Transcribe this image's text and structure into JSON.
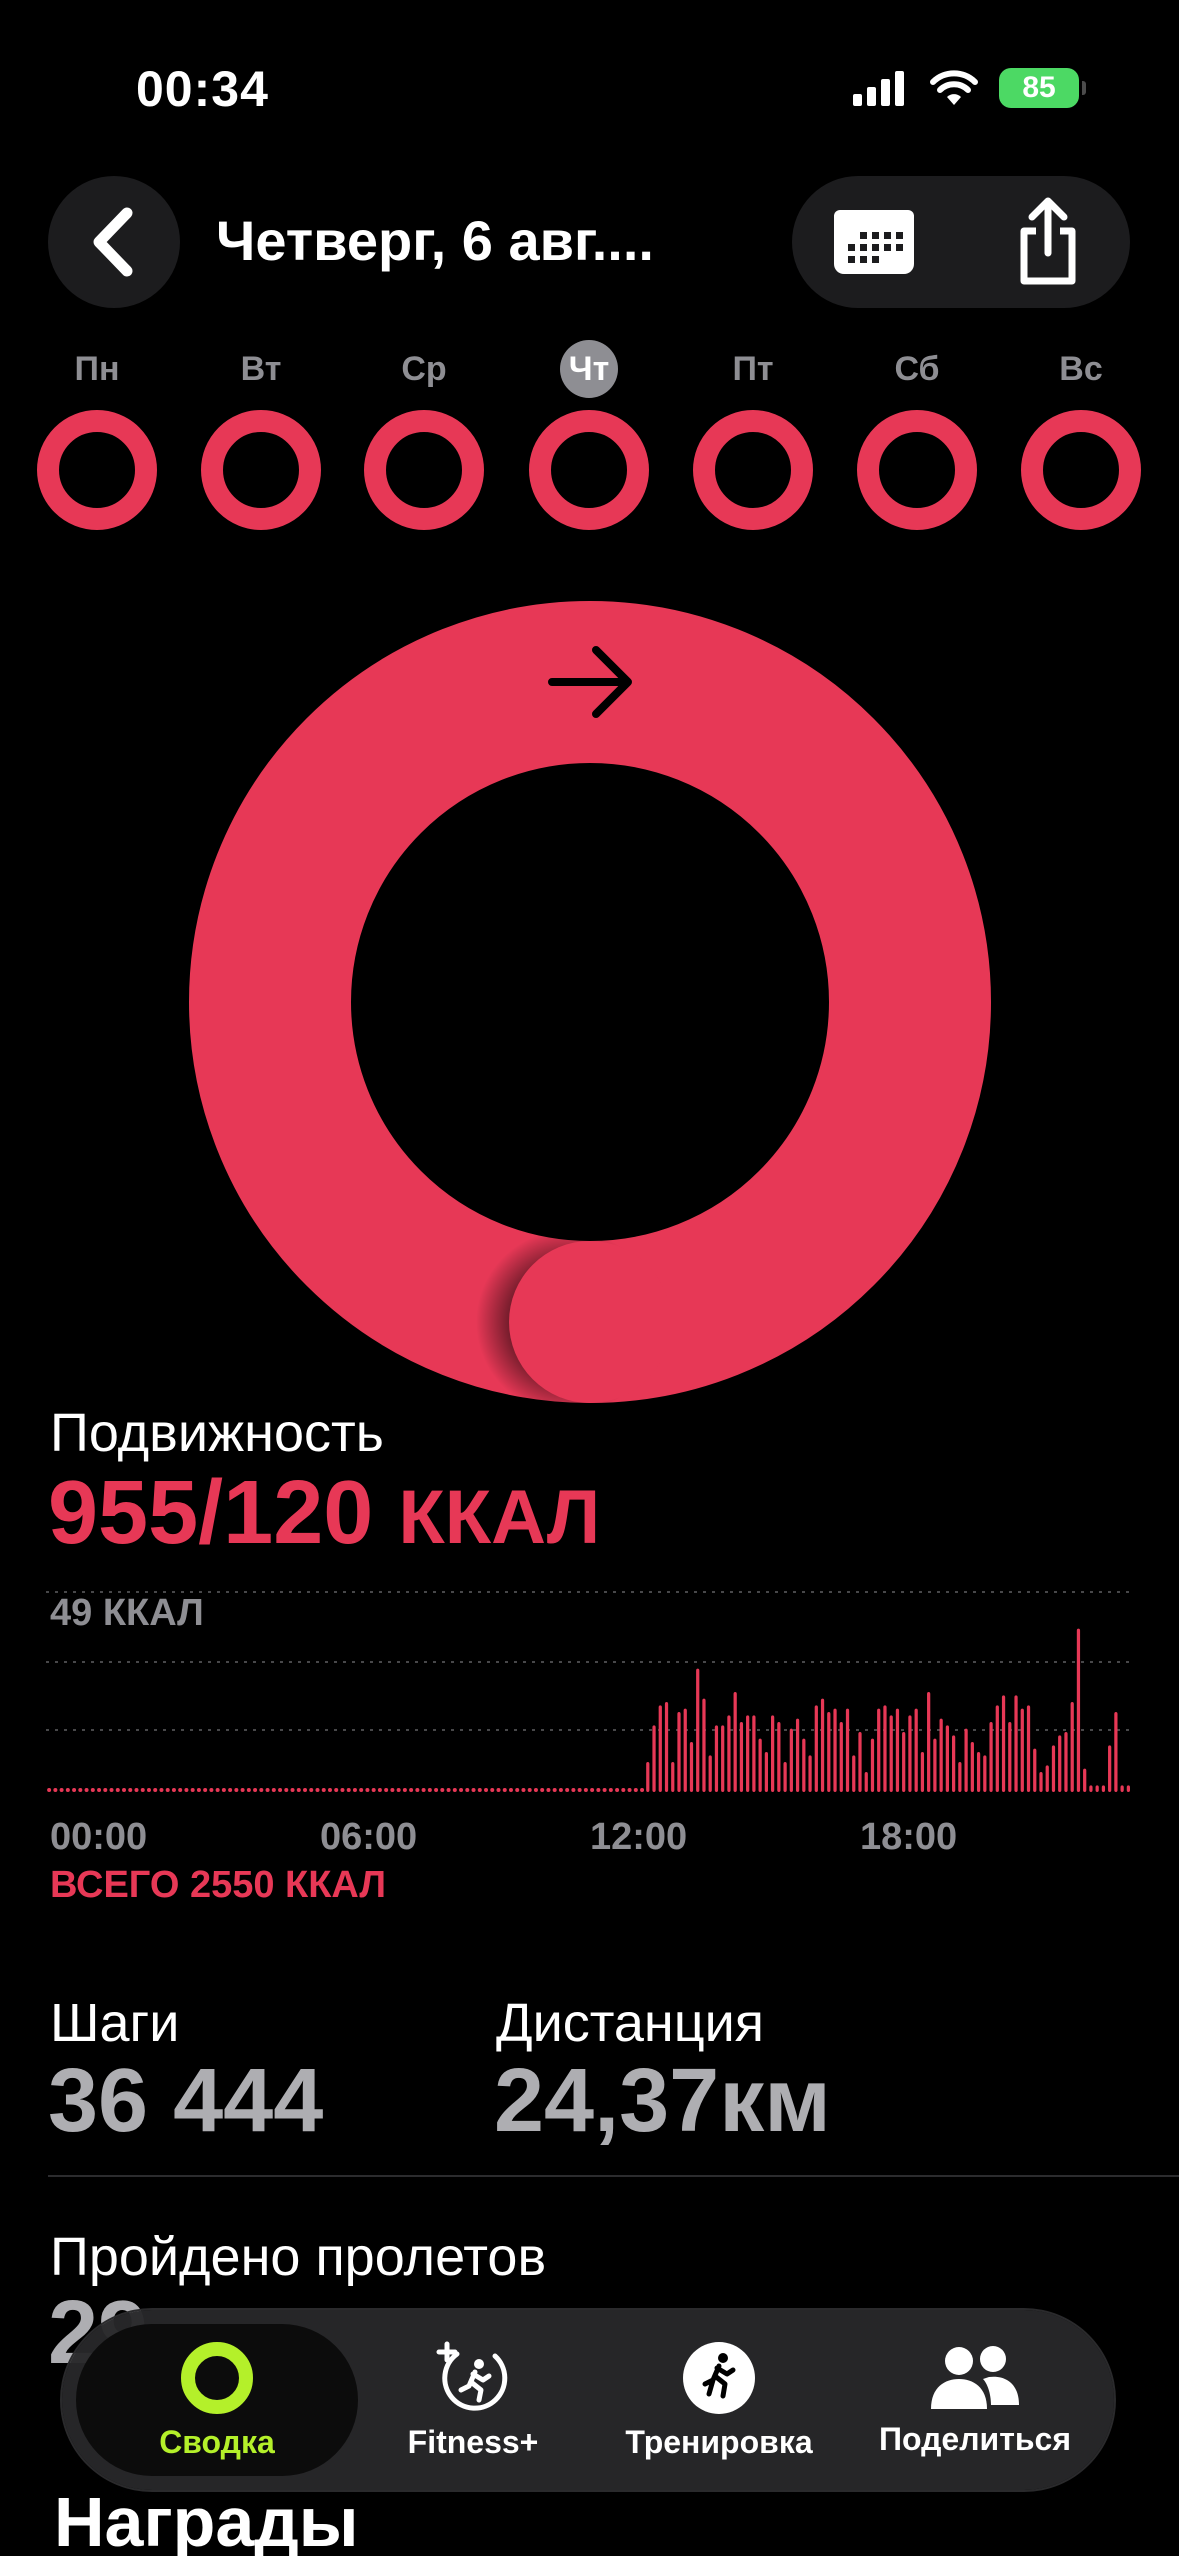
{
  "status_bar": {
    "time": "00:34",
    "battery": "85"
  },
  "header": {
    "title": "Четверг, 6 авг...."
  },
  "week": {
    "days": [
      "Пн",
      "Вт",
      "Ср",
      "Чт",
      "Пт",
      "Сб",
      "Вс"
    ],
    "selected": "Чт"
  },
  "move": {
    "label": "Подвижность",
    "value": "955/120",
    "unit": "ККАЛ",
    "goal_progress": 7.96
  },
  "hourly_chart": {
    "y_label": "49 ККАЛ",
    "x_ticks": [
      "00:00",
      "06:00",
      "12:00",
      "18:00"
    ],
    "total": "ВСЕГО 2550 ККАЛ"
  },
  "chart_data": {
    "type": "bar",
    "ylim": [
      0,
      60
    ],
    "values": [
      0,
      0,
      0,
      0,
      0,
      0,
      0,
      0,
      0,
      0,
      0,
      0,
      0,
      0,
      0,
      0,
      0,
      0,
      0,
      0,
      0,
      0,
      0,
      0,
      0,
      0,
      0,
      0,
      0,
      0,
      0,
      0,
      0,
      0,
      0,
      0,
      0,
      0,
      0,
      0,
      0,
      0,
      0,
      0,
      0,
      0,
      0,
      0,
      0,
      0,
      0,
      0,
      0,
      0,
      0,
      0,
      0,
      0,
      0,
      0,
      0,
      0,
      0,
      0,
      0,
      0,
      0,
      0,
      0,
      0,
      0,
      0,
      0,
      0,
      0,
      0,
      0,
      0,
      0,
      0,
      0,
      0,
      0,
      0,
      0,
      0,
      0,
      0,
      0,
      0,
      0,
      0,
      0,
      0,
      0,
      0,
      9,
      20,
      26,
      27,
      9,
      24,
      25,
      15,
      37,
      28,
      11,
      20,
      20,
      23,
      30,
      21,
      23,
      23,
      16,
      12,
      23,
      21,
      9,
      19,
      22,
      16,
      11,
      26,
      28,
      24,
      25,
      21,
      25,
      11,
      18,
      6,
      16,
      25,
      26,
      23,
      25,
      18,
      23,
      25,
      12,
      30,
      16,
      22,
      20,
      17,
      9,
      19,
      15,
      12,
      11,
      21,
      26,
      29,
      21,
      29,
      25,
      26,
      13,
      6,
      8,
      14,
      17,
      18,
      27,
      49,
      7,
      2,
      2,
      2,
      14,
      24,
      2,
      2
    ],
    "x_range": [
      "00:00",
      "24:00"
    ]
  },
  "stats": {
    "steps_label": "Шаги",
    "steps": "36 444",
    "distance_label": "Дистанция",
    "distance": "24,37км",
    "flights_label": "Пройдено пролетов",
    "flights": "29"
  },
  "tabbar": {
    "tabs": [
      "Сводка",
      "Fitness+",
      "Тренировка",
      "Поделиться"
    ],
    "active": "Сводка"
  },
  "awards_title": "Награды",
  "colors": {
    "move": "#e73856",
    "accent": "#b4f02a",
    "muted": "#8e8e93"
  }
}
